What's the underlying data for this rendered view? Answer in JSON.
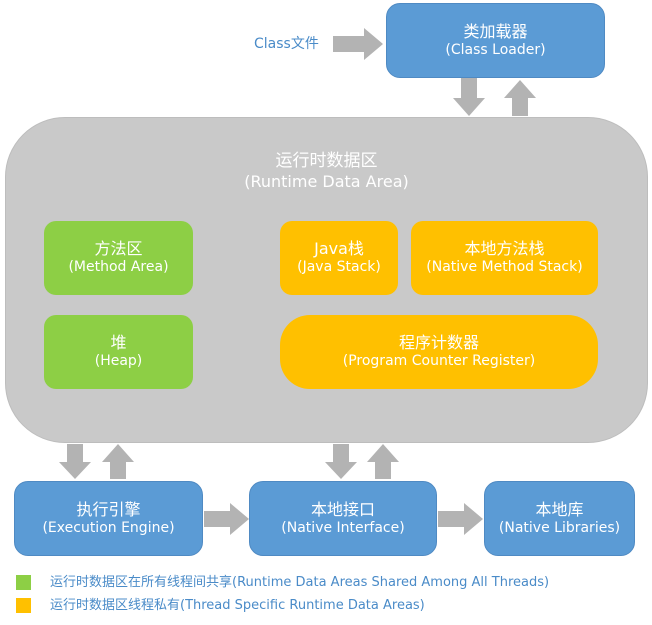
{
  "class_file": {
    "label": "Class文件"
  },
  "class_loader": {
    "title": "类加载器",
    "subtitle": "(Class Loader)"
  },
  "runtime_area": {
    "title": "运行时数据区",
    "subtitle": "(Runtime Data Area)"
  },
  "method_area": {
    "title": "方法区",
    "subtitle": "(Method Area)"
  },
  "heap": {
    "title": "堆",
    "subtitle": "(Heap)"
  },
  "java_stack": {
    "title": "Java栈",
    "subtitle": "(Java Stack)"
  },
  "native_method_stack": {
    "title": "本地方法栈",
    "subtitle": "(Native Method Stack)"
  },
  "program_counter": {
    "title": "程序计数器",
    "subtitle": "(Program Counter Register)"
  },
  "execution_engine": {
    "title": "执行引擎",
    "subtitle": "(Execution Engine)"
  },
  "native_interface": {
    "title": "本地接口",
    "subtitle": "(Native Interface)"
  },
  "native_libraries": {
    "title": "本地库",
    "subtitle": "(Native Libraries)"
  },
  "legend": {
    "shared": {
      "label": "运行时数据区在所有线程间共享(Runtime Data Areas Shared Among All Threads)"
    },
    "private": {
      "label": "运行时数据区线程私有(Thread Specific Runtime Data Areas)"
    }
  },
  "colors": {
    "shared": "#8dcf45",
    "private": "#ffc000",
    "component": "#5b9bd5",
    "runtime_area": "#c9c9c9",
    "arrow": "#b3b3b3"
  }
}
